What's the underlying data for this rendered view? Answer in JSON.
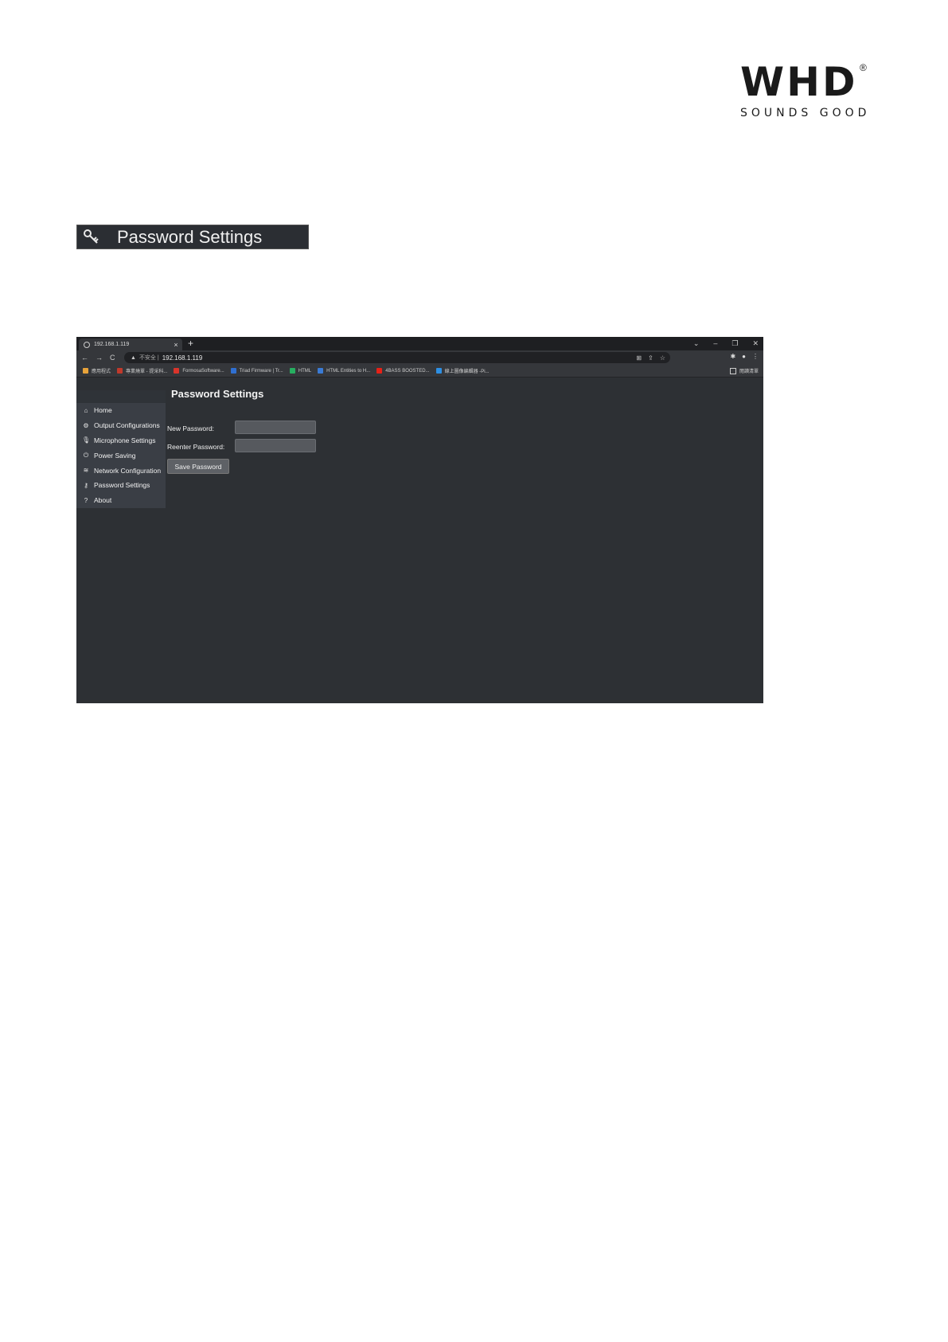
{
  "logo": {
    "word": "WHD",
    "registered": "®",
    "tagline": "SOUNDS GOOD"
  },
  "section": {
    "title": "Password Settings",
    "icon": "key-icon"
  },
  "browser": {
    "tab": {
      "title": "192.168.1.119",
      "close": "×"
    },
    "newtab": "+",
    "window_controls": [
      "⌄",
      "–",
      "❐",
      "✕"
    ],
    "nav": {
      "back": "←",
      "forward": "→",
      "reload": "C"
    },
    "address": {
      "warning": "▲",
      "not_secure": "不安全 |",
      "url": "192.168.1.119"
    },
    "omnibox_icons": [
      "⊞",
      "⇪",
      "☆"
    ],
    "right_icons": [
      "✱",
      "●",
      "⋮"
    ],
    "bookmarks": [
      {
        "label": "應用程式",
        "color": "#e8a33a"
      },
      {
        "label": "專業燒單 - 提采科...",
        "color": "#c0392b"
      },
      {
        "label": "FormosaSoftware...",
        "color": "#d9342b"
      },
      {
        "label": "Triad Firmware | Tr...",
        "color": "#2f6fd1"
      },
      {
        "label": "HTML",
        "color": "#27ae60"
      },
      {
        "label": "HTML Entities to H...",
        "color": "#3a7bd5"
      },
      {
        "label": "4BASS BOOSTED...",
        "color": "#e62117"
      },
      {
        "label": "線上圖像編輯器 -Pi...",
        "color": "#2d8fe3"
      }
    ],
    "reading_list": "閱讀清單"
  },
  "app": {
    "title": "Password Settings",
    "nav_items": [
      {
        "label": "Home",
        "icon": "⌂"
      },
      {
        "label": "Output Configurations",
        "icon": "⚙"
      },
      {
        "label": "Microphone Settings",
        "icon": "🎙"
      },
      {
        "label": "Power Saving",
        "icon": "⏻"
      },
      {
        "label": "Network Configuration",
        "icon": "≋"
      },
      {
        "label": "Password Settings",
        "icon": "⚷"
      },
      {
        "label": "About",
        "icon": "?"
      }
    ],
    "form": {
      "new_password_label": "New Password:",
      "new_password_value": "",
      "reenter_password_label": "Reenter Password:",
      "reenter_password_value": "",
      "save_label": "Save Password"
    }
  }
}
